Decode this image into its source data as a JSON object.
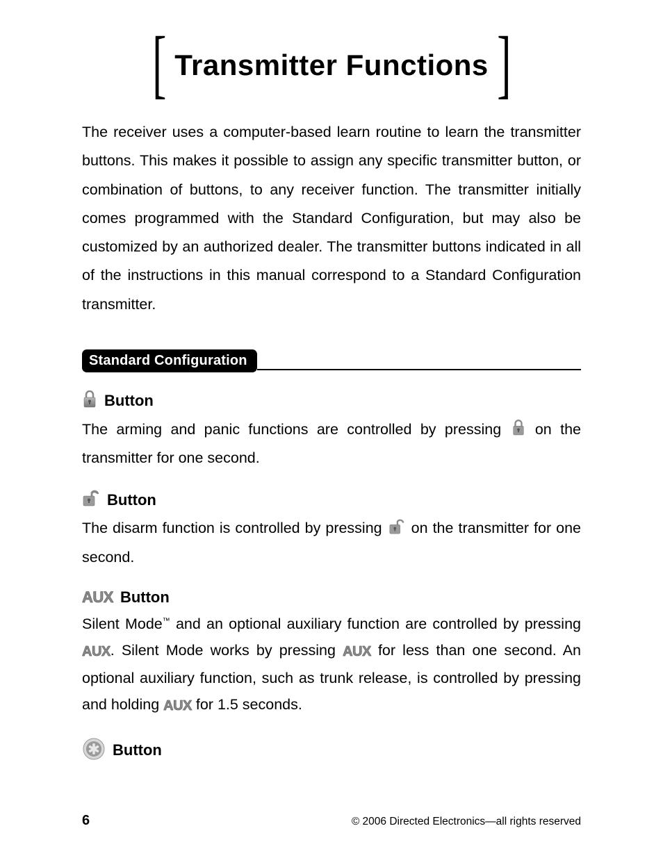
{
  "title": "Transmitter Functions",
  "intro": "The receiver uses a computer-based learn routine to learn the transmitter buttons. This makes it possible to assign any specific transmitter button, or combination of buttons, to any receiver function. The transmitter initially comes programmed with the Standard Configuration, but may also be customized by an authorized dealer. The transmitter buttons indicated in all of the instructions in this manual correspond to a Standard Configuration transmitter.",
  "section_heading": "Standard Configuration",
  "entries": {
    "lock": {
      "label": "Button",
      "body_before": "The arming and panic functions are controlled by pressing ",
      "body_after": " on the transmitter for one second."
    },
    "unlock": {
      "label": "Button",
      "body_before": "The disarm function is controlled by pressing ",
      "body_after": " on the transmitter for one second."
    },
    "aux": {
      "label": "Button",
      "aux_label": "AUX",
      "p1_a": "Silent Mode",
      "p1_tm": "™",
      "p1_b": " and an optional auxiliary function are controlled by pressing ",
      "p1_c": ". Silent Mode works by pressing ",
      "p1_d": " for less than one second. An optional auxiliary function, such as trunk release, is controlled by pressing and holding ",
      "p1_e": " for 1.5 seconds."
    },
    "star": {
      "label": "Button"
    }
  },
  "footer": {
    "page": "6",
    "copyright": "© 2006 Directed Electronics—all rights reserved"
  }
}
